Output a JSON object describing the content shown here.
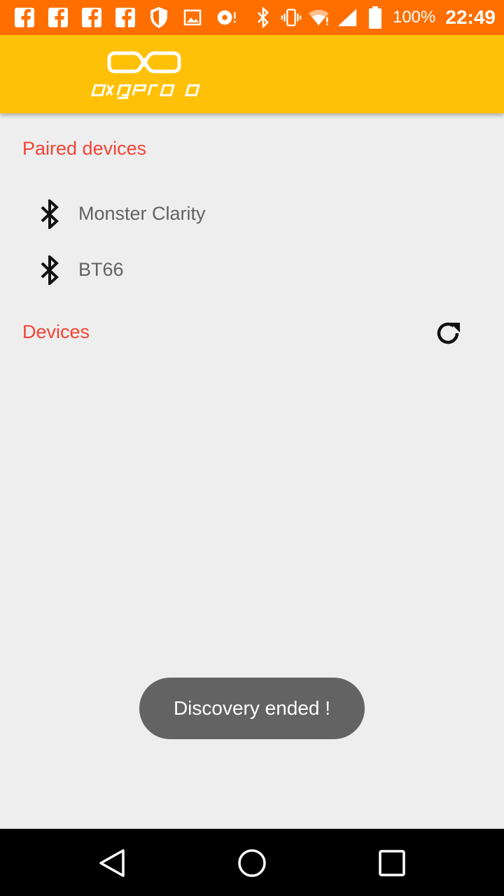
{
  "status_bar": {
    "battery_percent": "100%",
    "clock": "22:49",
    "bar_color": "#ff6f00",
    "left_icons": [
      "facebook-icon",
      "facebook-icon",
      "facebook-icon",
      "facebook-icon",
      "shield-icon",
      "image-icon",
      "sync-icon"
    ],
    "right_icons": [
      "bluetooth-icon",
      "vibrate-icon",
      "wifi-alert-icon",
      "cell-signal-icon",
      "battery-icon"
    ]
  },
  "app_bar": {
    "logo_text": "oxgero",
    "color": "#ffc107"
  },
  "paired": {
    "header": "Paired devices",
    "items": [
      {
        "name": "Monster Clarity",
        "icon": "bluetooth-icon"
      },
      {
        "name": "BT66",
        "icon": "bluetooth-icon"
      }
    ]
  },
  "devices": {
    "header": "Devices",
    "refresh_icon": "refresh-icon"
  },
  "toast": {
    "message": "Discovery ended !"
  },
  "nav_bar": {
    "icons": [
      "back-icon",
      "home-icon",
      "recent-apps-icon"
    ]
  },
  "colors": {
    "accent_red": "#f44336",
    "text_gray": "#616161",
    "background": "#eeeeee"
  }
}
